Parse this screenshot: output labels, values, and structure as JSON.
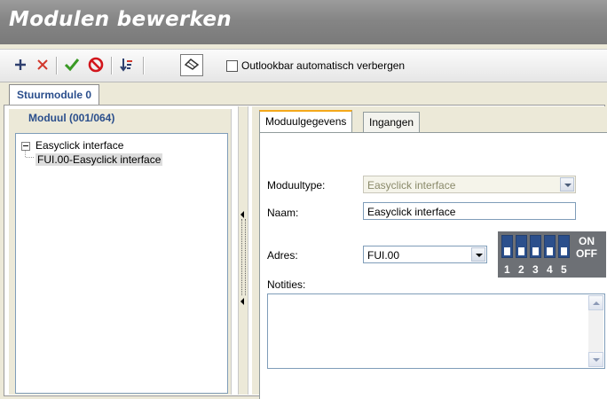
{
  "window": {
    "title": "Modulen bewerken"
  },
  "toolbar": {
    "outlookbar_label": "Outlookbar automatisch verbergen",
    "icons": [
      "add-icon",
      "delete-icon",
      "confirm-icon",
      "cancel-icon",
      "sort-icon",
      "eraser-icon"
    ]
  },
  "tabs": {
    "main": "Stuurmodule 0"
  },
  "left": {
    "header": "Moduul (001/064)",
    "tree": {
      "root": "Easyclick interface",
      "child": "FUI.00-Easyclick interface"
    }
  },
  "right": {
    "tabs": [
      "Moduulgegevens",
      "Ingangen"
    ],
    "fields": {
      "moduletype_label": "Moduultype:",
      "moduletype_value": "Easyclick interface",
      "name_label": "Naam:",
      "name_value": "Easyclick interface",
      "address_label": "Adres:",
      "address_value": "FUI.00",
      "notes_label": "Notities:"
    },
    "dip": {
      "on": "ON",
      "off": "OFF",
      "numbers": [
        "1",
        "2",
        "3",
        "4",
        "5"
      ]
    }
  },
  "colors": {
    "title_bar": "#858585",
    "accent_blue": "#2a4e8c",
    "tab_highlight": "#f4a81a",
    "dip_switch": "#2b4f8c"
  }
}
